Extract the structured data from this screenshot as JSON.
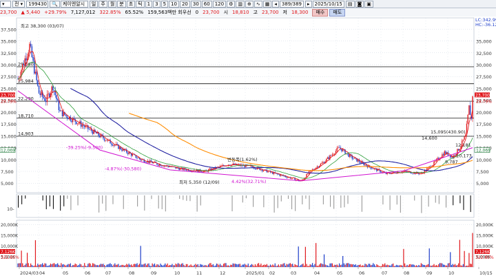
{
  "toolbar": {
    "code": "199430",
    "name": "케이엔알시",
    "period_tabs": [
      "주",
      "월",
      "분",
      "초",
      "틱"
    ],
    "minute_tabs": [
      "1",
      "3",
      "5",
      "10",
      "20",
      "30",
      "60",
      "120"
    ],
    "count": "389",
    "total": "389",
    "date": "2025/10/15"
  },
  "infobar": {
    "price": "23,700",
    "change": "5,440",
    "change_pct": "+29.79%",
    "volume": "7,127,012",
    "turnover_pct": "322.85%",
    "ratio": "65.52%",
    "amount": "159,563백만",
    "pref_label": "회우선",
    "pref_value": "0",
    "current_price": "23,700",
    "open_label": "시",
    "open": "18,810",
    "high_label": "고",
    "high": "23,700",
    "low_label": "저",
    "low": "18,300",
    "sell_label": "매수",
    "buy_label": "매도"
  },
  "price_chart": {
    "left_axis": [
      "37,500",
      "35,000",
      "32,500",
      "30,000",
      "27,500",
      "25,000",
      "22,500",
      "20,000",
      "17,500",
      "15,000",
      "12,500",
      "10,000",
      "7,500",
      "5,000"
    ],
    "right_axis": [
      "35,000",
      "32,500",
      "30,000",
      "27,500",
      "25,000",
      "22,500",
      "20,000",
      "17,500",
      "15,000",
      "12,500",
      "10,000",
      "7,500",
      "5,000"
    ],
    "hlines": [
      {
        "price": 29560,
        "label": "29,560"
      },
      {
        "price": 25984,
        "label": "25,984"
      },
      {
        "price": 22290,
        "label": "22,290"
      },
      {
        "price": 18710,
        "label": "18,710"
      },
      {
        "price": 14903,
        "label": "14,903"
      }
    ],
    "annotations": {
      "high": "최고 38,300 (03/07)",
      "low": "최저 5,350 (12/09)",
      "a1": "-39.25%(-9,500)",
      "a2": "-4.87%(-30,580)",
      "a3": "4.42%(32.71%)",
      "a4": "변동폭(1.62%)",
      "a5": "15,095(430.90)",
      "a6": "14,600",
      "a7": "12,181",
      "a8": "10,173",
      "a9": "9,787",
      "right_top1": "LC:342.99",
      "right_top2": "HC:-36.12",
      "right_price": "23,700",
      "right_pct": "29.79%",
      "left_price": "23,700",
      "left_pct": "29.79%",
      "left_ma": "12,069",
      "right_ma": "12,069"
    }
  },
  "indicator": {
    "label": "10-"
  },
  "volume_chart": {
    "left_axis": [
      "20,000K",
      "15,000K",
      "10,000K",
      "5,000K"
    ],
    "right_axis": [
      "20,000K",
      "15,000K",
      "10,000K",
      "5,000K"
    ],
    "left_vol": "7,126K",
    "left_pct": "322.85%",
    "right_vol": "7,126K",
    "right_pct": "322.85%"
  },
  "x_axis": [
    "2024/03",
    "04",
    "05",
    "06",
    "07",
    "08",
    "09",
    "10",
    "11",
    "12",
    "2025/01",
    "02",
    "03",
    "04",
    "05",
    "06",
    "07",
    "08",
    "09",
    "10",
    "10/15"
  ],
  "colors": {
    "up": "#e0171c",
    "down": "#1c3cc9",
    "ma5": "#e0171c",
    "ma20": "#ff8c00",
    "ma60": "#1f1fa0",
    "trend": "#d010d0",
    "grid": "#c9d3e0"
  }
}
